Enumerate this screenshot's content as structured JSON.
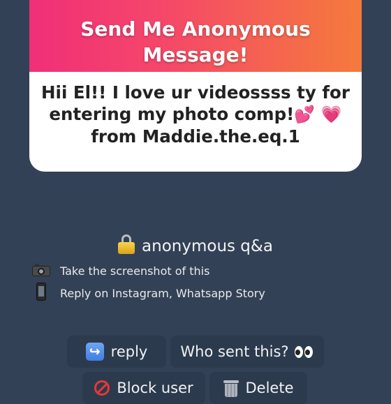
{
  "card": {
    "title_line1": "Send Me Anonymous",
    "title_line2": "Message!",
    "message_line1": "Hii El!! I love ur videossss ty for",
    "message_line2": "entering my photo comp!",
    "message_emoji1": "💕",
    "message_emoji2": "💗",
    "message_line3": "from Maddie.the.eq.1",
    "header_gradient": [
      "#f02f78",
      "#f57a3c"
    ]
  },
  "section": {
    "title": "anonymous q&a",
    "icon": "lock-icon"
  },
  "steps": [
    {
      "icon": "camera-icon",
      "text": "Take the screenshot of this"
    },
    {
      "icon": "phone-icon",
      "text": "Reply on Instagram, Whatsapp Story"
    }
  ],
  "actions": {
    "reply": {
      "label": "reply",
      "icon": "reply-icon"
    },
    "who_sent": {
      "label": "Who sent this?",
      "icon": "eyes-icon"
    },
    "block": {
      "label": "Block user",
      "icon": "no-entry-icon"
    },
    "delete": {
      "label": "Delete",
      "icon": "trash-icon"
    }
  },
  "colors": {
    "background": "#334156",
    "button_bg": "#2c3a4e"
  }
}
